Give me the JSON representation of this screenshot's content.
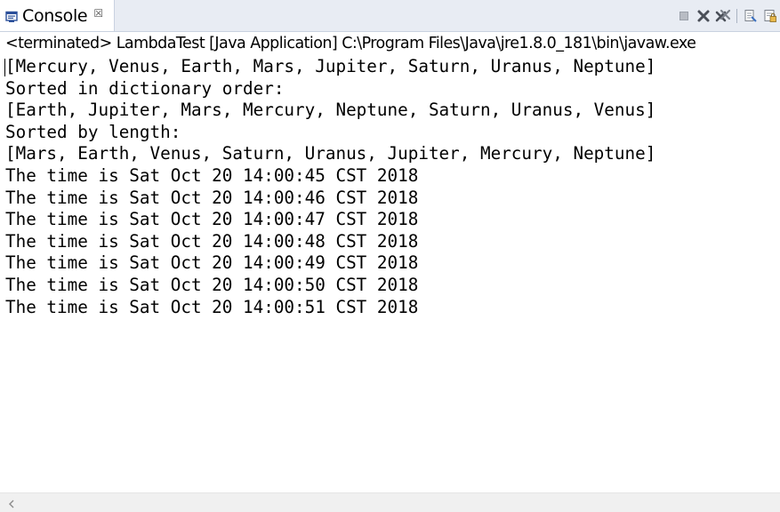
{
  "tab": {
    "label": "Console",
    "close_glyph": "☒",
    "icon": "console-icon"
  },
  "toolbar": {
    "icons": [
      "terminate-icon",
      "remove-launch-icon",
      "remove-all-terminated-icon",
      "clear-console-icon",
      "scroll-lock-icon"
    ]
  },
  "status": {
    "text": "<terminated> LambdaTest [Java Application] C:\\Program Files\\Java\\jre1.8.0_181\\bin\\javaw.exe"
  },
  "console": {
    "lines": [
      "[Mercury, Venus, Earth, Mars, Jupiter, Saturn, Uranus, Neptune]",
      "Sorted in dictionary order:",
      "[Earth, Jupiter, Mars, Mercury, Neptune, Saturn, Uranus, Venus]",
      "Sorted by length:",
      "[Mars, Earth, Venus, Saturn, Uranus, Jupiter, Mercury, Neptune]",
      "The time is Sat Oct 20 14:00:45 CST 2018",
      "The time is Sat Oct 20 14:00:46 CST 2018",
      "The time is Sat Oct 20 14:00:47 CST 2018",
      "The time is Sat Oct 20 14:00:48 CST 2018",
      "The time is Sat Oct 20 14:00:49 CST 2018",
      "The time is Sat Oct 20 14:00:50 CST 2018",
      "The time is Sat Oct 20 14:00:51 CST 2018"
    ]
  },
  "colors": {
    "tabbar_bg": "#e8ecf3",
    "text": "#000000",
    "scroll_bg": "#f0f0f0"
  }
}
